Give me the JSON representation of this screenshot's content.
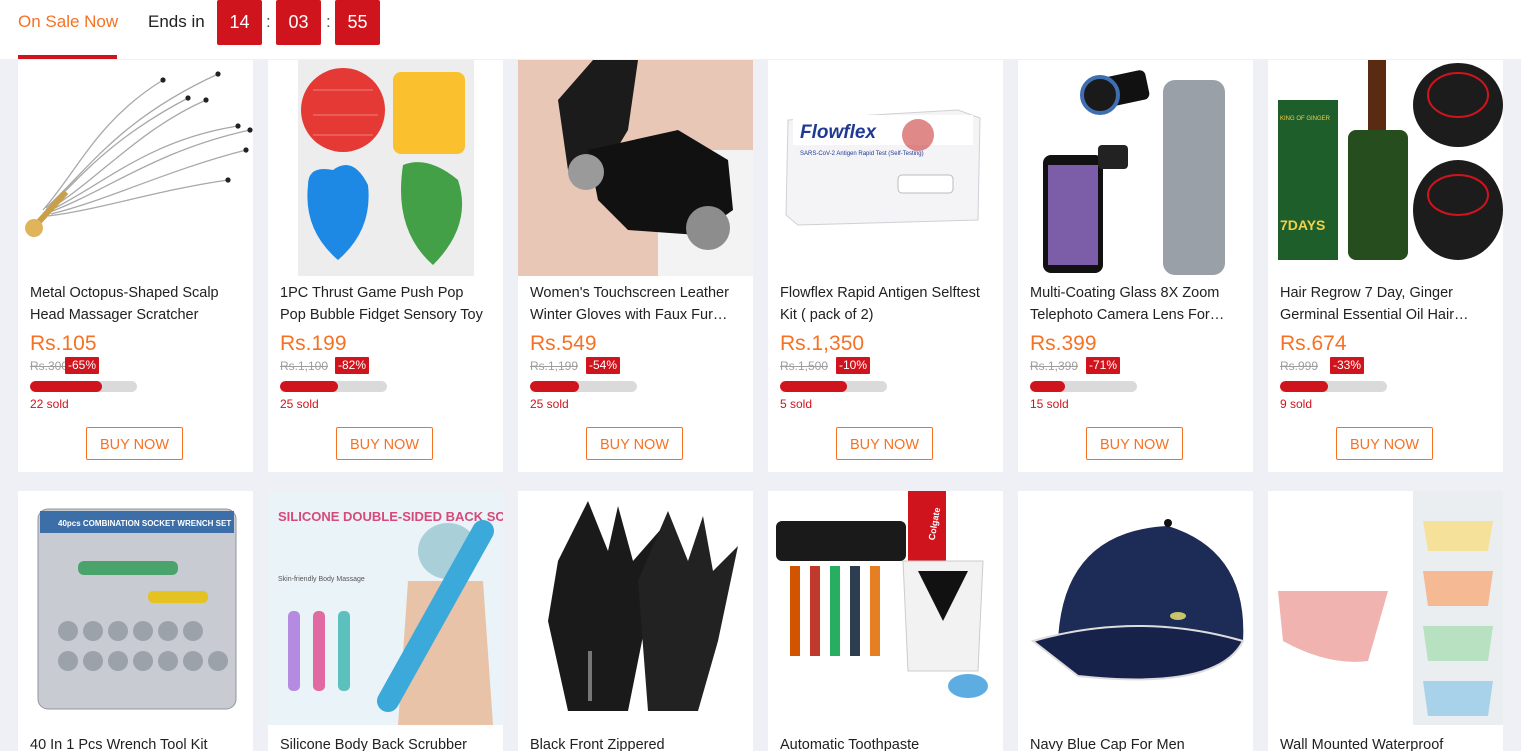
{
  "header": {
    "tab_label": "On Sale Now",
    "ends_in": "Ends in",
    "timer": {
      "hours": "14",
      "minutes": "03",
      "seconds": "55",
      "sep": ":"
    }
  },
  "colors": {
    "accent_orange": "#f57224",
    "red": "#d0141d",
    "bg": "#eff0f5"
  },
  "products": [
    {
      "name": "Metal Octopus-Shaped Scalp Head Massager Scratcher",
      "price": "Rs.105",
      "old_price": "Rs.300",
      "discount": "-65%",
      "sold_fraction": 0.67,
      "sold": "22 sold",
      "button": "BUY NOW",
      "image": "scalp-massager-image"
    },
    {
      "name": "1PC Thrust Game Push Pop Pop Bubble Fidget Sensory Toy",
      "price": "Rs.199",
      "old_price": "Rs.1,100",
      "discount": "-82%",
      "sold_fraction": 0.54,
      "sold": "25 sold",
      "button": "BUY NOW",
      "image": "fidget-toy-image"
    },
    {
      "name": "Women's Touchscreen Leather Winter Gloves with Faux Fur…",
      "price": "Rs.549",
      "old_price": "Rs.1,199",
      "discount": "-54%",
      "sold_fraction": 0.46,
      "sold": "25 sold",
      "button": "BUY NOW",
      "image": "leather-gloves-image"
    },
    {
      "name": "Flowflex Rapid Antigen Selftest Kit ( pack of 2)",
      "price": "Rs.1,350",
      "old_price": "Rs.1,500",
      "discount": "-10%",
      "sold_fraction": 0.63,
      "sold": "5 sold",
      "button": "BUY NOW",
      "image": "flowflex-kit-image"
    },
    {
      "name": "Multi-Coating Glass 8X Zoom Telephoto Camera Lens For…",
      "price": "Rs.399",
      "old_price": "Rs.1,399",
      "discount": "-71%",
      "sold_fraction": 0.33,
      "sold": "15 sold",
      "button": "BUY NOW",
      "image": "phone-lens-image"
    },
    {
      "name": "Hair Regrow 7 Day, Ginger Germinal Essential Oil Hair…",
      "price": "Rs.674",
      "old_price": "Rs.999",
      "discount": "-33%",
      "sold_fraction": 0.45,
      "sold": "9 sold",
      "button": "BUY NOW",
      "image": "hair-oil-image"
    },
    {
      "name": "40 In 1 Pcs Wrench Tool Kit",
      "image": "wrench-kit-image",
      "image_text": "40pcs COMBINATION SOCKET WRENCH SET"
    },
    {
      "name": "Silicone Body Back Scrubber",
      "image": "back-scrubber-image",
      "image_text": "SILICONE DOUBLE-SIDED BACK SCRUBBER",
      "image_subtext": "Skin-friendly Body Massage"
    },
    {
      "name": "Black Front Zippered",
      "image": "black-gloves-image"
    },
    {
      "name": "Automatic Toothpaste",
      "image": "toothpaste-dispenser-image",
      "image_text": "Colgate"
    },
    {
      "name": "Navy Blue Cap For Men",
      "image": "navy-cap-image"
    },
    {
      "name": "Wall Mounted Waterproof",
      "image": "corner-shelf-image"
    }
  ],
  "image_labels": {
    "flowflex_brand": "Flowflex",
    "flowflex_sub": "SARS-CoV-2 Antigen Rapid Test (Self-Testing)",
    "hair_oil_brand": "7DAYS",
    "hair_oil_sub": "KING OF GINGER"
  }
}
